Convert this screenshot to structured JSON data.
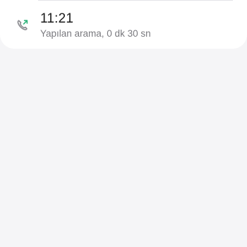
{
  "call_log": {
    "entries": [
      {
        "time": "11:21",
        "description": "Yapılan arama, 0 dk 30 sn",
        "icon": "outgoing-call-icon",
        "icon_color": "#8a8a8f",
        "arrow_color": "#2fb37a"
      }
    ]
  }
}
